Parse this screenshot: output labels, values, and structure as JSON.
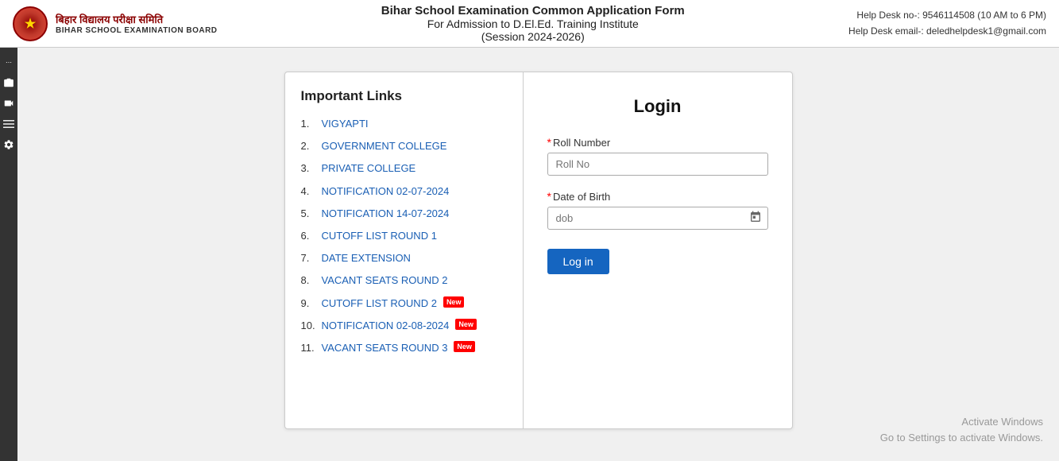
{
  "header": {
    "logo_hindi": "बिहार विद्यालय परीक्षा समिति",
    "logo_english": "BIHAR SCHOOL EXAMINATION BOARD",
    "title_line1": "Bihar School Examination Common Application Form",
    "title_line2": "For Admission to D.El.Ed. Training Institute",
    "title_line3": "(Session 2024-2026)",
    "help_phone": "Help Desk no-: 9546114508 (10 AM to 6 PM)",
    "help_email": "Help Desk email-: deledhelpdesk1@gmail.com"
  },
  "links_panel": {
    "heading": "Important Links",
    "links": [
      {
        "num": "1.",
        "label": "VIGYAPTI",
        "badge": ""
      },
      {
        "num": "2.",
        "label": "GOVERNMENT COLLEGE",
        "badge": ""
      },
      {
        "num": "3.",
        "label": "PRIVATE COLLEGE",
        "badge": ""
      },
      {
        "num": "4.",
        "label": "NOTIFICATION 02-07-2024",
        "badge": ""
      },
      {
        "num": "5.",
        "label": "NOTIFICATION 14-07-2024",
        "badge": ""
      },
      {
        "num": "6.",
        "label": "CUTOFF LIST ROUND 1",
        "badge": ""
      },
      {
        "num": "7.",
        "label": "DATE EXTENSION",
        "badge": ""
      },
      {
        "num": "8.",
        "label": "VACANT SEATS ROUND 2",
        "badge": ""
      },
      {
        "num": "9.",
        "label": "CUTOFF LIST ROUND 2",
        "badge": "New"
      },
      {
        "num": "10.",
        "label": "NOTIFICATION 02-08-2024",
        "badge": "New"
      },
      {
        "num": "11.",
        "label": "VACANT SEATS ROUND 3",
        "badge": "New"
      }
    ]
  },
  "login_panel": {
    "heading": "Login",
    "roll_label": "Roll Number",
    "roll_placeholder": "Roll No",
    "dob_label": "Date of Birth",
    "dob_placeholder": "dob",
    "login_button": "Log in"
  },
  "activate_windows": {
    "line1": "Activate Windows",
    "line2": "Go to Settings to activate Windows."
  },
  "left_bar": {
    "icons": [
      "⋯",
      "📷",
      "🎥",
      "▬",
      "⚙"
    ]
  }
}
